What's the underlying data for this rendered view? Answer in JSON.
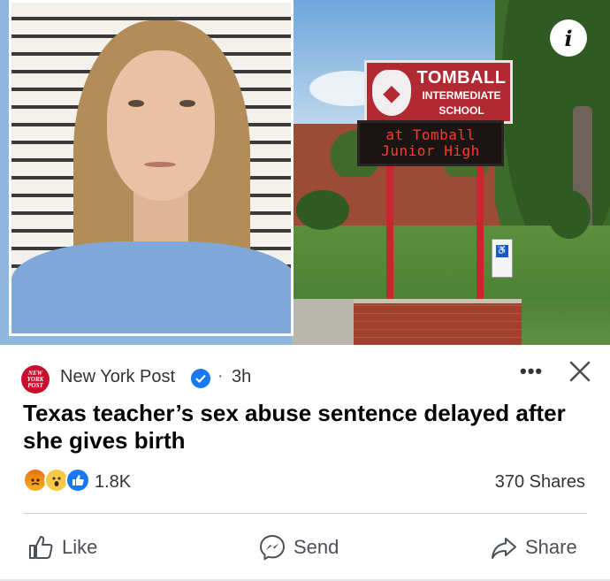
{
  "media": {
    "sign_line1": "TOMBALL",
    "sign_line2": "INTERMEDIATE",
    "sign_line3": "SCHOOL",
    "led_line1": "at Tomball",
    "led_line2": "Junior High",
    "info_icon": "info-icon",
    "info_glyph": "i"
  },
  "post": {
    "source_logo_text": [
      "NEW",
      "YORK",
      "POST"
    ],
    "source_name": "New York Post",
    "verified_icon": "verified-badge-icon",
    "separator": "·",
    "time": "3h",
    "more_icon": "more-options-icon",
    "more_glyph": "•••",
    "close_icon": "close-icon",
    "headline": "Texas teacher’s sex abuse sentence delayed after she gives birth"
  },
  "engagement": {
    "reactions": [
      "angry",
      "wow",
      "like"
    ],
    "reaction_count": "1.8K",
    "shares": "370 Shares"
  },
  "actions": {
    "like": "Like",
    "send": "Send",
    "share": "Share"
  },
  "colors": {
    "brand_blue": "#1877f2",
    "nyp_red": "#c8102e",
    "sign_red": "#b22a31",
    "text_primary": "#050505",
    "text_secondary": "#4b4f56"
  }
}
